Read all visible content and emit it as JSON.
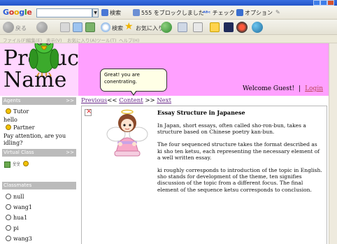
{
  "browser": {
    "google_label": "Google",
    "search_label": "検索",
    "blocked_label": "555 をブロックしました",
    "check_label": "チェック",
    "options_label": "オプション",
    "back_label": "戻る",
    "favorites_label": "お気に入り",
    "menu": [
      "ファイル(F)",
      "編集(E)",
      "表示(V)",
      "お気に入り(A)",
      "ツール(T)",
      "ヘルプ(H)"
    ]
  },
  "header": {
    "product_name_line1": "Product",
    "product_name_line2": "Name",
    "welcome": "Welcome Guest!",
    "separator": "|",
    "login": "Login"
  },
  "speech": {
    "text": "Great! you are conentrating."
  },
  "sidebar": {
    "agents_title": "Agents",
    "agents_arrow": ">>",
    "tutor": "Tutor",
    "tutor_message": "hello",
    "partner": "Partner",
    "partner_message_1": "Pay attention, are you",
    "partner_message_2": "idling?",
    "virtual_class_title": "Virtual Class",
    "virtual_class_arrow": ">>",
    "classmates_title": "Classmates",
    "classmates": [
      "null",
      "wang1",
      "hua1",
      "pi",
      "wang3"
    ]
  },
  "nav": {
    "previous": "Previous",
    "sep1": "<<",
    "content": "Content",
    "sep2": ">>",
    "next": "Next"
  },
  "article": {
    "title": "Essay Structure in Japanese",
    "p1": "In Japan, short essays, often called sho-ron-bun, takes a structure based on Chinese poetry kan-bun.",
    "p2": "The four sequenced structure takes the format described as ki sho ten ketsu, each representing the necessary element of a well written essay.",
    "p3": "ki roughly corresponds to introduction of the topic in English. sho stands for development of the theme, ten signifies discussion of the topic from a different focus. The final element of the sequence ketsu corresponds to conclusion."
  }
}
